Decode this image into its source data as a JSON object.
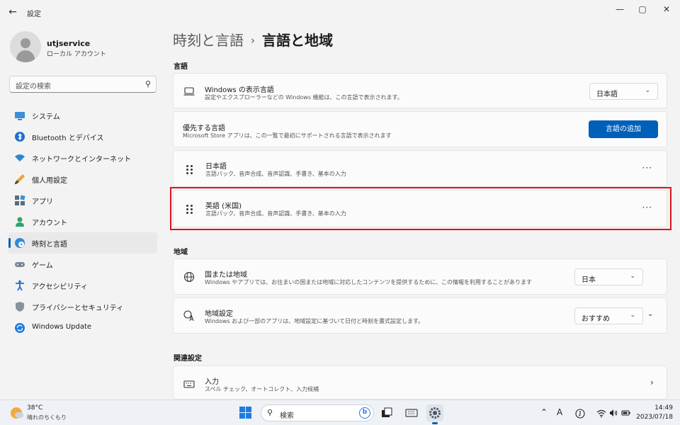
{
  "window": {
    "app_title": "設定",
    "back_icon": "←",
    "controls": {
      "minimize": "—",
      "maximize": "▢",
      "close": "✕"
    }
  },
  "profile": {
    "name": "utjservice",
    "account_type": "ローカル アカウント"
  },
  "sidebar": {
    "search_placeholder": "設定の検索",
    "items": [
      {
        "label": "システム",
        "icon": "monitor-icon"
      },
      {
        "label": "Bluetooth とデバイス",
        "icon": "bluetooth-icon"
      },
      {
        "label": "ネットワークとインターネット",
        "icon": "wifi-icon"
      },
      {
        "label": "個人用設定",
        "icon": "brush-icon"
      },
      {
        "label": "アプリ",
        "icon": "apps-icon"
      },
      {
        "label": "アカウント",
        "icon": "person-icon"
      },
      {
        "label": "時刻と言語",
        "icon": "globe-clock-icon",
        "active": true
      },
      {
        "label": "ゲーム",
        "icon": "gamepad-icon"
      },
      {
        "label": "アクセシビリティ",
        "icon": "accessibility-icon"
      },
      {
        "label": "プライバシーとセキュリティ",
        "icon": "shield-icon"
      },
      {
        "label": "Windows Update",
        "icon": "update-icon"
      }
    ]
  },
  "breadcrumb": {
    "parent": "時刻と言語",
    "separator": "›",
    "current": "言語と地域"
  },
  "sections": {
    "language": {
      "heading": "言語",
      "display_language": {
        "title": "Windows の表示言語",
        "subtitle": "設定やエクスプローラーなどの Windows 機能は、この言語で表示されます。",
        "value": "日本語"
      },
      "preferred": {
        "title": "優先する言語",
        "subtitle": "Microsoft Store アプリは、この一覧で最初にサポートされる言語で表示されます",
        "button": "言語の追加"
      },
      "languages": [
        {
          "name": "日本語",
          "features": "言語パック、音声合成、音声認識、手書き、基本の入力"
        },
        {
          "name": "英語 (米国)",
          "features": "言語パック、音声合成、音声認識、手書き、基本の入力"
        }
      ],
      "more_icon": "···"
    },
    "region": {
      "heading": "地域",
      "country": {
        "title": "国または地域",
        "subtitle": "Windows やアプリでは、お住まいの国または地域に対応したコンテンツを提供するために、この情報を利用することがあります",
        "value": "日本"
      },
      "format": {
        "title": "地域設定",
        "subtitle": "Windows および一部のアプリは、地域設定に基づいて日付と時刻を書式設定します。",
        "value": "おすすめ"
      }
    },
    "related": {
      "heading": "関連設定",
      "input": {
        "title": "入力",
        "subtitle": "スペル チェック、オートコレクト、入力候補"
      }
    }
  },
  "dropdown_chevron": "⌄",
  "taskbar": {
    "weather": {
      "temp": "38°C",
      "desc": "晴れのちくもり"
    },
    "search_placeholder": "検索",
    "bing_label": "b",
    "tray": {
      "chevron": "⌃",
      "ime": "A"
    },
    "time": "14:49",
    "date": "2023/07/18"
  }
}
